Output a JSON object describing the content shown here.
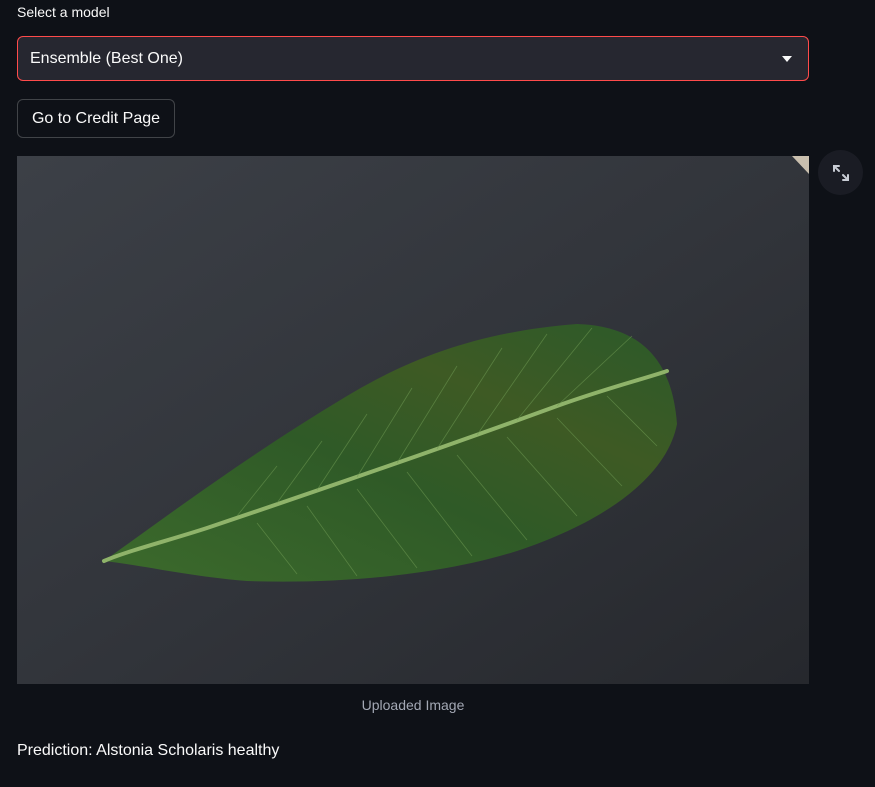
{
  "model_select": {
    "label": "Select a model",
    "selected": "Ensemble (Best One)",
    "accent": "#ff4b4b"
  },
  "credit_button": {
    "label": "Go to Credit Page"
  },
  "image": {
    "caption": "Uploaded Image",
    "fullscreen_icon": "expand-icon"
  },
  "prediction": {
    "text": "Prediction: Alstonia Scholaris healthy"
  },
  "colors": {
    "background": "#0e1117",
    "widget": "#262730",
    "text": "#fafafa",
    "caption": "#a3a8b4"
  }
}
